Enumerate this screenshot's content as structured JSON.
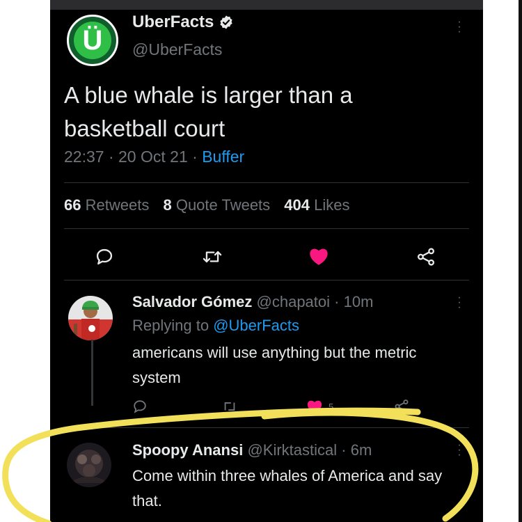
{
  "main_tweet": {
    "author_name": "UberFacts",
    "author_handle": "@UberFacts",
    "avatar_letter": "Ü",
    "text": "A blue whale is larger than a basketball court",
    "time": "22:37",
    "date": "20 Oct 21",
    "source": "Buffer",
    "separator": " · ",
    "stats": {
      "retweets_count": "66",
      "retweets_label": "Retweets",
      "quotes_count": "8",
      "quotes_label": "Quote Tweets",
      "likes_count": "404",
      "likes_label": "Likes"
    }
  },
  "replies": [
    {
      "name": "Salvador Gómez",
      "handle": "@chapatoi",
      "time": "10m",
      "replying_prefix": "Replying to",
      "replying_to": "@UberFacts",
      "text": "americans will use anything but the metric system",
      "likes": "5"
    },
    {
      "name": "Spoopy Anansi",
      "handle": "@Kirktastical",
      "time": "6m",
      "text": "Come within three whales of America and say that."
    }
  ],
  "colors": {
    "background": "#000000",
    "text": "#e7e9ea",
    "secondary": "#71767b",
    "link": "#1d9bf0",
    "like": "#f91880",
    "highlight": "#f3e05a"
  },
  "icons": [
    "verified-badge-icon",
    "more-options-icon",
    "reply-icon",
    "retweet-icon",
    "like-icon",
    "share-icon"
  ]
}
